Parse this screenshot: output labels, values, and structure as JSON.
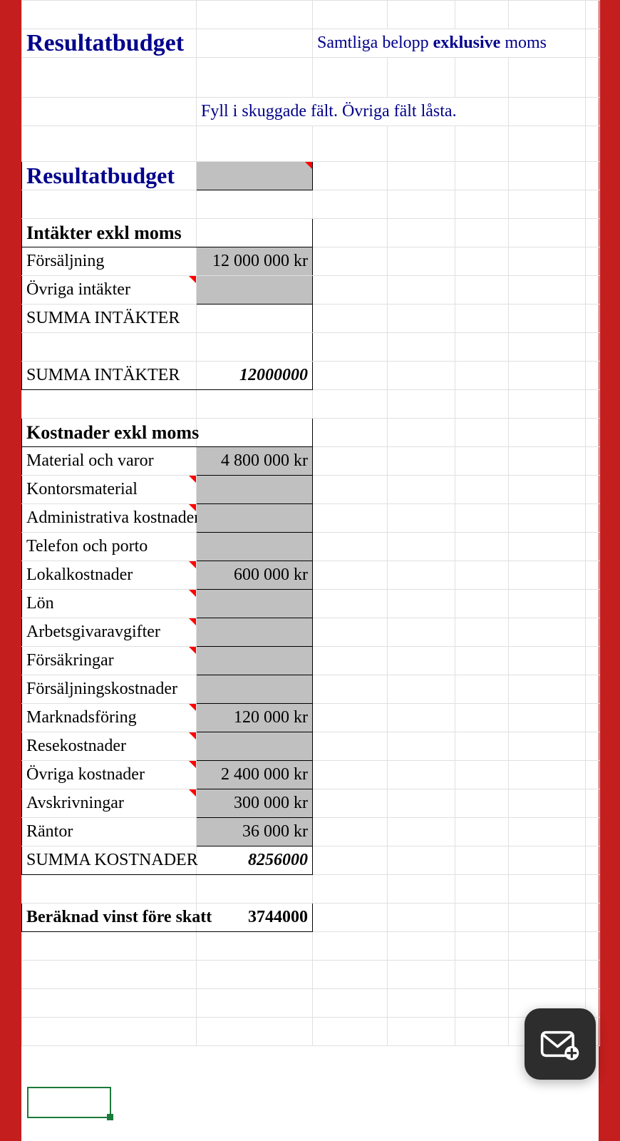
{
  "header": {
    "title": "Resultatbudget",
    "subtitle_prefix": "Samtliga belopp ",
    "subtitle_bold": "exklusive",
    "subtitle_suffix": " moms",
    "instruction": "Fyll i skuggade fält. Övriga fält låsta."
  },
  "section_title": "Resultatbudget",
  "income": {
    "heading": "Intäkter exkl moms",
    "rows": [
      {
        "label": "Försäljning",
        "value": "12 000 000 kr"
      },
      {
        "label": "Övriga intäkter",
        "value": ""
      }
    ],
    "sum_label_1": "SUMMA INTÄKTER",
    "sum_label_2": "SUMMA INTÄKTER",
    "sum_value": "12000000"
  },
  "costs": {
    "heading": "Kostnader exkl moms",
    "rows": [
      {
        "label": "Material och varor",
        "value": "4 800 000 kr"
      },
      {
        "label": "Kontorsmaterial",
        "value": ""
      },
      {
        "label": "Administrativa kostnader",
        "value": ""
      },
      {
        "label": "Telefon och porto",
        "value": ""
      },
      {
        "label": "Lokalkostnader",
        "value": "600 000 kr"
      },
      {
        "label": "Lön",
        "value": ""
      },
      {
        "label": "Arbetsgivaravgifter",
        "value": ""
      },
      {
        "label": "Försäkringar",
        "value": ""
      },
      {
        "label": "Försäljningskostnader",
        "value": ""
      },
      {
        "label": "Marknadsföring",
        "value": "120 000 kr"
      },
      {
        "label": "Resekostnader",
        "value": ""
      },
      {
        "label": "Övriga kostnader",
        "value": "2 400 000 kr"
      },
      {
        "label": "Avskrivningar",
        "value": "300 000 kr"
      },
      {
        "label": "Räntor",
        "value": "36 000 kr"
      }
    ],
    "sum_label": "SUMMA KOSTNADER",
    "sum_value": "8256000"
  },
  "profit": {
    "label": "Beräknad vinst före skatt",
    "value": "3744000"
  }
}
